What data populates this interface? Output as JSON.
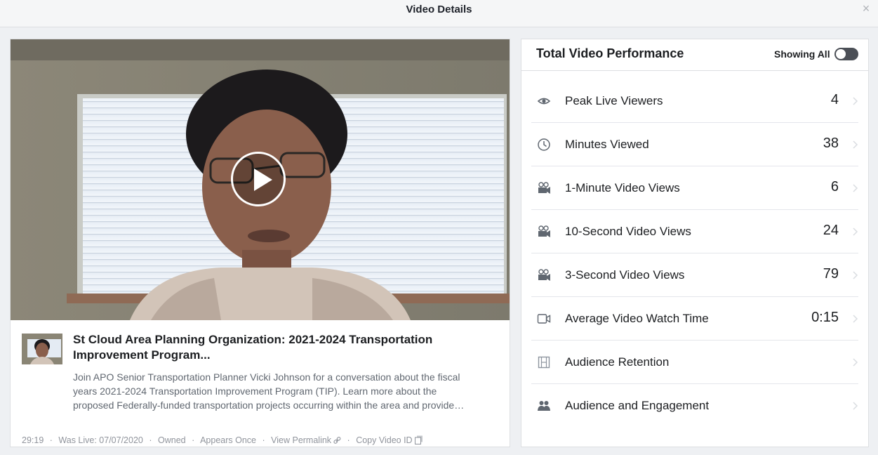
{
  "dialog": {
    "title": "Video Details",
    "close_glyph": "×"
  },
  "video": {
    "title_line1": "St Cloud Area Planning Organization: 2021-2024 Transportation",
    "title_line2": "Improvement Program...",
    "desc_line1": "Join APO Senior Transportation Planner Vicki Johnson for a conversation about the fiscal",
    "desc_line2": "years 2021-2024 Transportation Improvement Program (TIP). Learn more about the",
    "desc_line3": "proposed Federally-funded transportation projects occurring within the area and provide…",
    "meta": {
      "duration": "29:19",
      "was_live": "Was Live: 07/07/2020",
      "owned": "Owned",
      "appears": "Appears Once",
      "permalink": "View Permalink",
      "copy_id": "Copy Video ID",
      "separator": "·"
    }
  },
  "performance": {
    "title": "Total Video Performance",
    "showing_label": "Showing All",
    "toggle_on": false,
    "metrics": [
      {
        "label": "Peak Live Viewers",
        "value": "4",
        "icon": "eye-icon"
      },
      {
        "label": "Minutes Viewed",
        "value": "38",
        "icon": "clock-icon"
      },
      {
        "label": "1-Minute Video Views",
        "value": "6",
        "icon": "film-camera-icon"
      },
      {
        "label": "10-Second Video Views",
        "value": "24",
        "icon": "film-camera-icon"
      },
      {
        "label": "3-Second Video Views",
        "value": "79",
        "icon": "film-camera-icon"
      },
      {
        "label": "Average Video Watch Time",
        "value": "0:15",
        "icon": "video-camera-icon"
      },
      {
        "label": "Audience Retention",
        "value": "",
        "icon": "film-strip-icon"
      },
      {
        "label": "Audience and Engagement",
        "value": "",
        "icon": "people-icon"
      }
    ]
  },
  "colors": {
    "accent_toggle": "#4b4f56",
    "text_primary": "#1c1e21",
    "text_secondary": "#606770",
    "text_meta": "#90949c"
  }
}
